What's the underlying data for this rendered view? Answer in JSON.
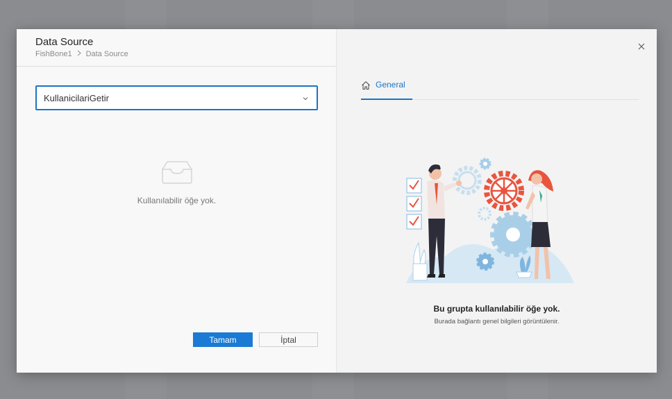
{
  "dialog": {
    "title": "Data Source",
    "breadcrumb": [
      "FishBone1",
      "Data Source"
    ]
  },
  "select": {
    "value": "KullanicilariGetir"
  },
  "empty_state": {
    "message": "Kullanılabilir öğe yok."
  },
  "buttons": {
    "ok": "Tamam",
    "cancel": "İptal"
  },
  "right_panel": {
    "tab_general": "General",
    "empty_title": "Bu grupta kullanılabilir öğe yok.",
    "empty_subtitle": "Burada bağlantı genel bilgileri görüntülenir."
  },
  "colors": {
    "accent": "#1a73c8",
    "illustration_red": "#e8553f",
    "illustration_blue": "#a9cfe8"
  },
  "icons": {
    "close": "close-icon",
    "tab": "home-icon",
    "select": "chevron-down-icon",
    "empty": "empty-inbox-icon"
  }
}
